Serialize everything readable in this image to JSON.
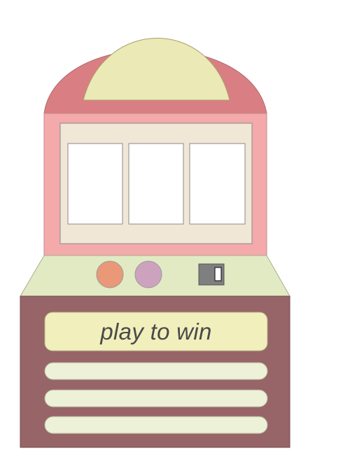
{
  "machine": {
    "banner_text": "play to win",
    "colors": {
      "dome": "#d97f83",
      "dome_inner": "#ebe9b6",
      "cabinet": "#f4a9aa",
      "screen_panel": "#f1e7d6",
      "reel": "#ffffff",
      "control_deck": "#e2eac4",
      "left_button": "#ea9877",
      "right_button": "#cda2bf",
      "coin_slot": "#7f7f7f",
      "base": "#976467",
      "banner": "#f1efbc",
      "bar": "#edf1d7"
    },
    "reels": [
      "",
      "",
      ""
    ],
    "controls": {
      "left_button_icon": "round-button",
      "right_button_icon": "round-button",
      "coin_slot_icon": "coin-slot-icon"
    }
  }
}
